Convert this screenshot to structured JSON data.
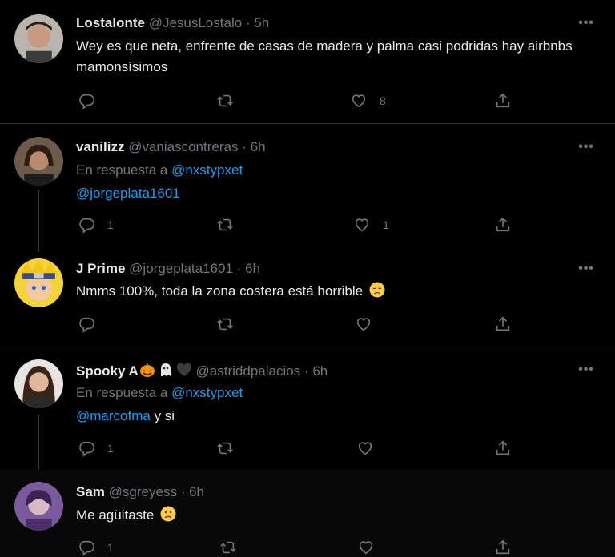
{
  "tweets": [
    {
      "name": "Lostalonte",
      "handle": "@JesusLostalo",
      "time": "5h",
      "text": "Wey es que neta, enfrente de casas de madera y palma casi podridas hay airbnbs mamonsísimos",
      "replies": "",
      "retweets": "",
      "likes": "8"
    },
    {
      "name": "vanilizz",
      "handle": "@vaniascontreras",
      "time": "6h",
      "reply_prefix": "En respuesta a",
      "reply_to": "@nxstypxet",
      "mention": "@jorgeplata1601",
      "replies": "1",
      "retweets": "",
      "likes": "1"
    },
    {
      "name": "J Prime",
      "handle": "@jorgeplata1601",
      "time": "6h",
      "text": "Nmms 100%, toda la zona costera está horrible",
      "replies": "",
      "retweets": "",
      "likes": ""
    },
    {
      "name": "Spooky A",
      "handle": "@astriddpalacios",
      "time": "6h",
      "reply_prefix": "En respuesta a",
      "reply_to": "@nxstypxet",
      "mention": "@marcofma",
      "text_after": "y si",
      "replies": "1",
      "retweets": "",
      "likes": ""
    },
    {
      "name": "Sam",
      "handle": "@sgreyess",
      "time": "6h",
      "text": "Me agüitaste",
      "replies": "1",
      "retweets": "",
      "likes": ""
    }
  ],
  "dot": "·",
  "more_label": "•••",
  "colors": {
    "background": "#000000",
    "text": "#e7e9ea",
    "secondary": "#71767b",
    "link": "#1d9bf0",
    "divider": "#2f3336"
  },
  "icons": [
    "reply-icon",
    "retweet-icon",
    "like-icon",
    "share-icon",
    "more-icon"
  ]
}
